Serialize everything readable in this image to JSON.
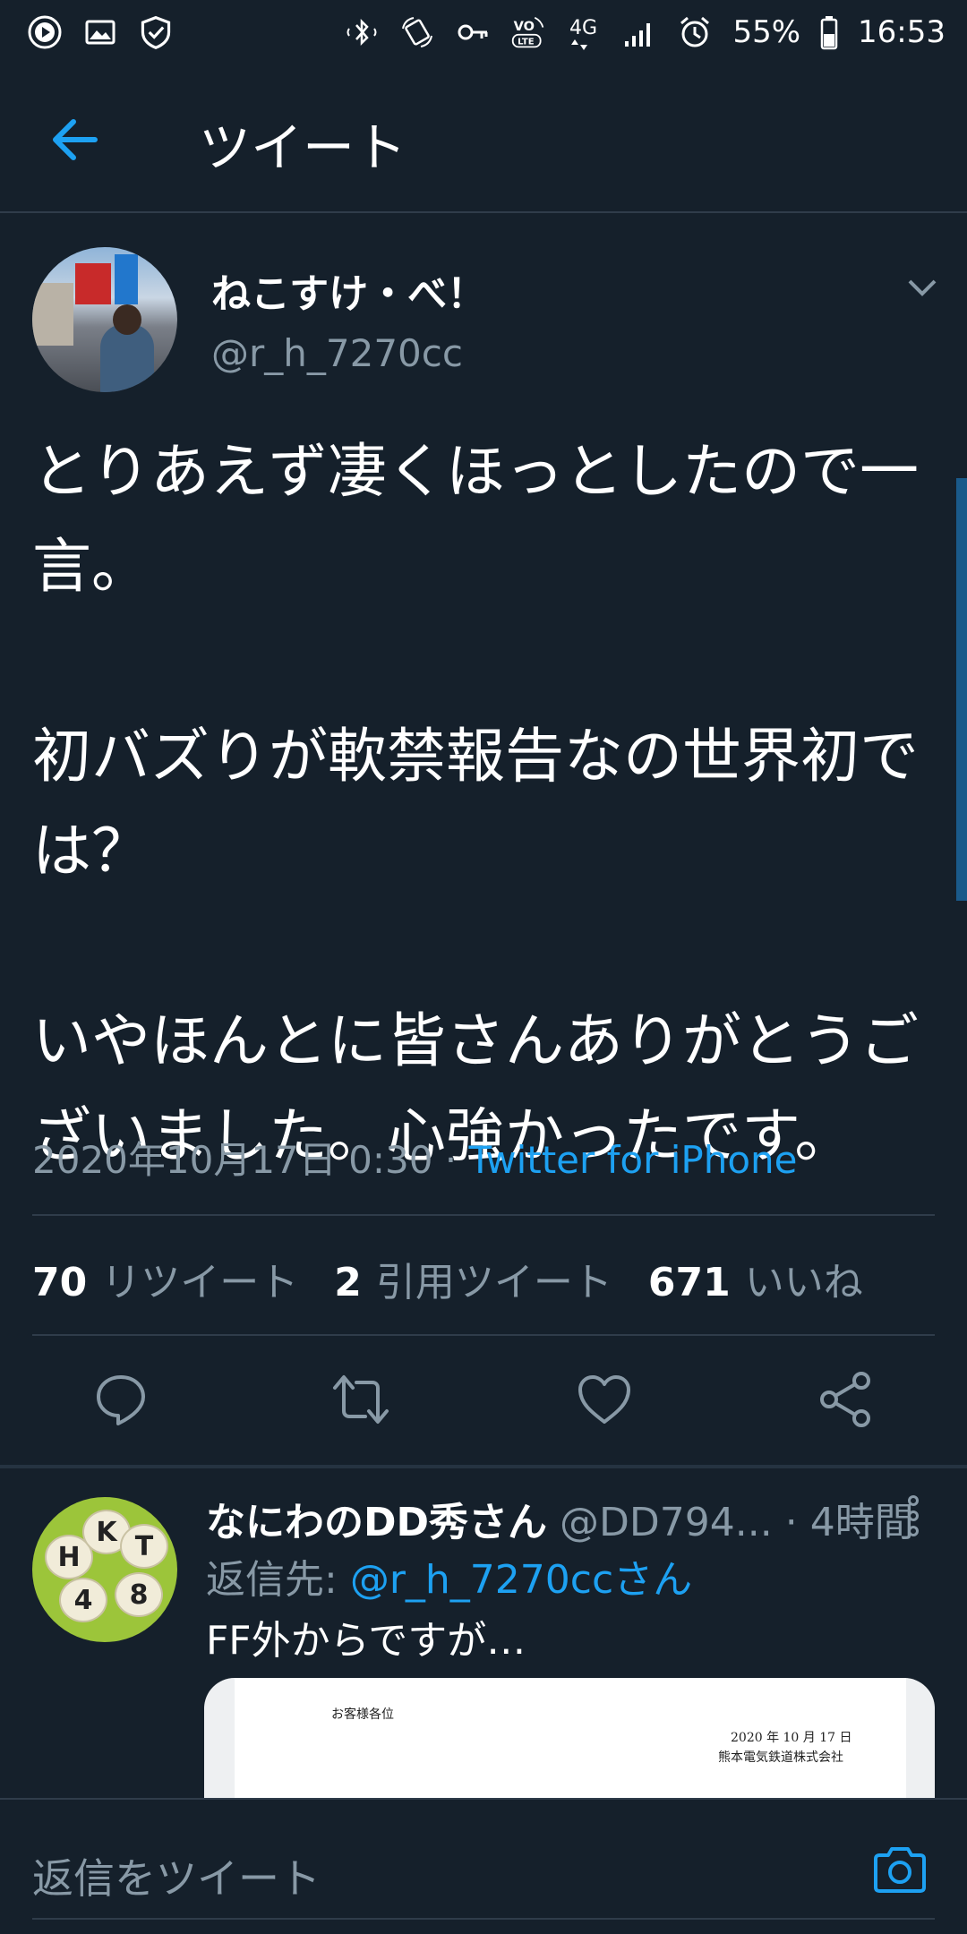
{
  "status_bar": {
    "battery": "55%",
    "time": "16:53",
    "network": "4G",
    "volte": "VO LTE",
    "icons_left": [
      "play-icon",
      "image-icon",
      "shield-check-icon"
    ],
    "icons_right": [
      "bluetooth-icon",
      "rotate-icon",
      "key-icon",
      "volte-icon",
      "network-4g-icon",
      "signal-icon",
      "alarm-icon",
      "battery-icon"
    ]
  },
  "header": {
    "title": "ツイート"
  },
  "tweet": {
    "author_name": "ねこすけ・べ！",
    "author_handle": "@r_h_7270cc",
    "body": "とりあえず凄くほっとしたので一\n言。\n\n初バズりが軟禁報告なの世界初で\nは？\n\nいやほんとに皆さんありがとうご\nざいました。心強かったです。",
    "timestamp": "2020年10月17日 0:30",
    "separator": " · ",
    "source": "Twitter for iPhone",
    "stats": {
      "retweets_count": "70",
      "retweets_label": "リツイート",
      "quotes_count": "2",
      "quotes_label": "引用ツイート",
      "likes_count": "671",
      "likes_label": "いいね"
    }
  },
  "reply": {
    "name": "なにわのDD秀さん",
    "handle": "@DD794...",
    "time": "· 4時間",
    "reply_to_prefix": "返信先: ",
    "reply_to_user": "@r_h_7270ccさん",
    "text": "FF外からですが…",
    "avatar_letters": [
      "H",
      "K",
      "T",
      "4",
      "8"
    ],
    "card": {
      "salutation": "お客様各位",
      "date": "2020 年 10 月 17 日",
      "company": "熊本電気鉄道株式会社"
    }
  },
  "compose": {
    "placeholder": "返信をツイート"
  },
  "colors": {
    "background": "#15202b",
    "accent": "#1da1f2",
    "muted": "#8899a6",
    "divider": "#2f3c4a"
  }
}
